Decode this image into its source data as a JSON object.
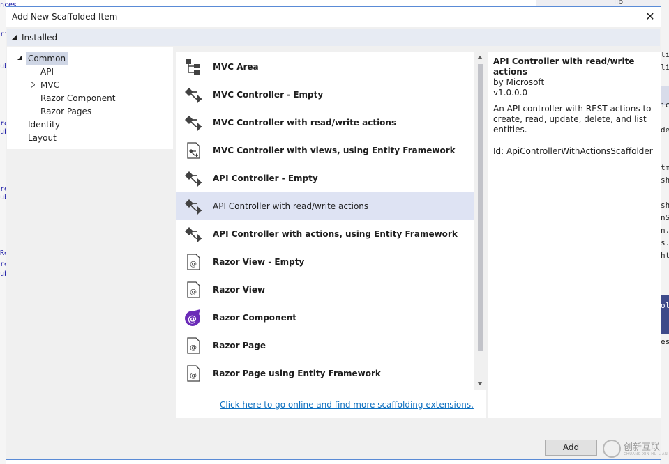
{
  "background": {
    "right_fragments": [
      "lic",
      "lic",
      "ic",
      "de",
      "tm",
      "sht",
      "sh",
      "nS",
      "n.c",
      "s.c",
      "ht",
      "olo",
      "es"
    ],
    "top_label": "lib",
    "left_fragments": [
      "nces",
      "ri",
      "ub",
      "re",
      "ub",
      "re",
      "ub",
      "Re",
      "re",
      "ub"
    ]
  },
  "dialog": {
    "title": "Add New Scaffolded Item",
    "close_glyph": "✕",
    "installed_label": "Installed"
  },
  "tree": {
    "items": [
      {
        "label": "Common",
        "selected": true
      },
      {
        "label": "API"
      },
      {
        "label": "MVC"
      },
      {
        "label": "Razor Component"
      },
      {
        "label": "Razor Pages"
      },
      {
        "label": "Identity"
      },
      {
        "label": "Layout"
      }
    ]
  },
  "templates": {
    "items": [
      {
        "label": "MVC Area",
        "icon": "area-icon"
      },
      {
        "label": "MVC Controller - Empty",
        "icon": "controller-icon"
      },
      {
        "label": "MVC Controller with read/write actions",
        "icon": "controller-icon"
      },
      {
        "label": "MVC Controller with views, using Entity Framework",
        "icon": "controller-views-icon"
      },
      {
        "label": "API Controller - Empty",
        "icon": "controller-icon"
      },
      {
        "label": "API Controller with read/write actions",
        "icon": "controller-icon",
        "selected": true
      },
      {
        "label": "API Controller with actions, using Entity Framework",
        "icon": "controller-icon"
      },
      {
        "label": "Razor View - Empty",
        "icon": "razor-view-icon"
      },
      {
        "label": "Razor View",
        "icon": "razor-view-icon"
      },
      {
        "label": "Razor Component",
        "icon": "blazor-icon"
      },
      {
        "label": "Razor Page",
        "icon": "razor-page-icon"
      },
      {
        "label": "Razor Page using Entity Framework",
        "icon": "razor-page-icon"
      }
    ],
    "online_link": "Click here to go online and find more scaffolding extensions."
  },
  "details": {
    "title": "API Controller with read/write actions",
    "author": "by Microsoft",
    "version": "v1.0.0.0",
    "description": "An API controller with REST actions to create, read, update, delete, and list entities.",
    "id": "Id: ApiControllerWithActionsScaffolder"
  },
  "footer": {
    "add_label": "Add"
  },
  "watermark": {
    "text": "创新互联",
    "sub": "CHUANG XIN HU LIAN"
  },
  "colors": {
    "selection": "#dee3f3",
    "tree_selection": "#cfd6e5",
    "link": "#0e70c0",
    "dialog_border": "#5a8bd6",
    "blazor_purple": "#6b2bb8"
  }
}
